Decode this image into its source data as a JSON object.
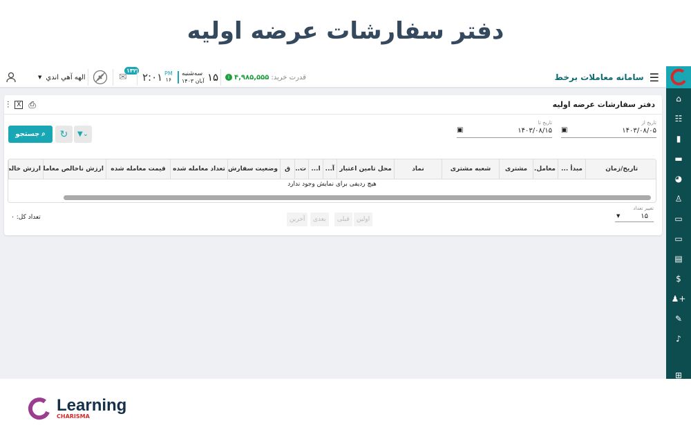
{
  "banner_title": "دفتر سفارشات عرضه اولیه",
  "topbar": {
    "app_title": "سامانه معاملات برخط",
    "buying_power_label": "قدرت خرید:",
    "buying_power_value": "۴,۹۸۵,۵۵۵",
    "day_number": "۱۵",
    "weekday": "سه‌شنبه",
    "month_year": "آبان ۱۴۰۳",
    "ampm": "PM",
    "seconds": "۱۶",
    "time": "۲:۰۱",
    "message_count": "۱۳۲",
    "user_name": "الهه آهي اندي"
  },
  "page": {
    "title": "دفتر سفارشات عرضه اولیه",
    "date_from_label": "تاریخ از",
    "date_from_value": "۱۴۰۳/۰۸/۰۵",
    "date_to_label": "تاریخ تا",
    "date_to_value": "۱۴۰۳/۰۸/۱۵",
    "search_label": "جستجو",
    "columns": [
      "تاریخ/زمان",
      "مبدأ ...",
      "معامل...",
      "مشتری",
      "شعبه مشتری",
      "نماد",
      "محل تامین اعتبار",
      "آ...",
      "ا...",
      "ت...",
      "ق",
      "وضعیت سفارش",
      "تعداد معامله شده",
      "قیمت معامله شده",
      "ارزش ناخالص معامله",
      "ارزش خالص"
    ],
    "empty_message": "هیچ ردیفی برای نمایش وجود ندارد",
    "page_size_label": "تغییر تعداد",
    "page_size_value": "۱۵",
    "pagination": {
      "first": "اولین",
      "prev": "قبلی",
      "next": "بعدی",
      "last": "آخرین"
    },
    "total_label": "تعداد کل: ۰"
  },
  "sidebar_icons": [
    "home-icon",
    "list-icon",
    "book-icon",
    "briefcase-icon",
    "pie-chart-icon",
    "reader-icon",
    "id-card-icon",
    "credit-card-icon",
    "document-icon",
    "dollar-icon",
    "user-plus-icon",
    "signature-icon",
    "bell-icon",
    "grid-icon"
  ],
  "logo": {
    "text": "Learning",
    "subtext": "CHARISMA"
  },
  "colors": {
    "accent": "#1aa7b5",
    "sidebar": "#0d4c4f",
    "positive": "#1e9e3e",
    "logo_red": "#d42a2a"
  }
}
